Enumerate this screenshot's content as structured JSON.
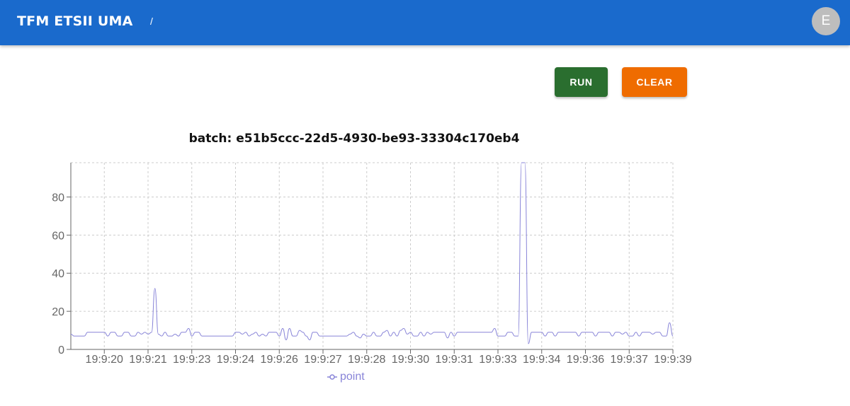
{
  "appbar": {
    "title": "TFM ETSII UMA",
    "breadcrumb_separator": "/",
    "avatar_initial": "E",
    "color": "#1a6acc"
  },
  "actions": {
    "run_label": "RUN",
    "clear_label": "CLEAR",
    "run_color": "#2a6e2f",
    "clear_color": "#ef6c00"
  },
  "chart_data": {
    "type": "line",
    "title": "batch: e51b5ccc-22d5-4930-be93-33304c170eb4",
    "xlabel": "",
    "ylabel": "",
    "ylim": [
      0,
      98
    ],
    "y_ticks": [
      0,
      20,
      40,
      60,
      80
    ],
    "x_tick_labels": [
      "19:9:20",
      "19:9:21",
      "19:9:23",
      "19:9:24",
      "19:9:26",
      "19:9:27",
      "19:9:28",
      "19:9:30",
      "19:9:31",
      "19:9:33",
      "19:9:34",
      "19:9:36",
      "19:9:37",
      "19:9:39"
    ],
    "grid": true,
    "legend_position": "bottom",
    "series": [
      {
        "name": "point",
        "color": "#8884d8",
        "values": [
          8,
          7,
          7,
          7,
          7,
          9,
          9,
          9,
          9,
          9,
          9,
          7,
          9,
          9,
          7,
          7,
          9,
          9,
          7,
          7,
          9,
          8,
          9,
          8,
          9,
          32,
          8,
          7,
          9,
          7,
          7,
          8,
          7,
          9,
          9,
          11,
          7,
          9,
          9,
          7,
          7,
          7,
          7,
          7,
          7,
          7,
          7,
          7,
          7,
          9,
          9,
          8,
          9,
          7,
          8,
          9,
          7,
          8,
          7,
          9,
          9,
          9,
          7,
          11,
          5,
          11,
          7,
          7,
          10,
          9,
          7,
          5,
          9,
          9,
          7,
          7,
          7,
          7,
          7,
          7,
          7,
          7,
          7,
          8,
          9,
          7,
          6,
          8,
          7,
          7,
          9,
          7,
          7,
          9,
          10,
          7,
          9,
          7,
          10,
          11,
          8,
          9,
          7,
          7,
          9,
          7,
          9,
          8,
          9,
          9,
          9,
          9,
          6,
          9,
          7,
          9,
          9,
          9,
          9,
          9,
          9,
          9,
          9,
          9,
          9,
          9,
          11,
          7,
          7,
          7,
          9,
          9,
          7,
          7,
          98,
          98,
          3,
          9,
          9,
          9,
          9,
          7,
          9,
          9,
          7,
          9,
          9,
          9,
          9,
          9,
          9,
          7,
          9,
          9,
          9,
          9,
          7,
          9,
          9,
          9,
          9,
          7,
          9,
          9,
          8,
          9,
          7,
          7,
          9,
          7,
          9,
          9,
          9,
          8,
          9,
          9,
          7,
          7,
          14,
          7
        ]
      }
    ]
  }
}
